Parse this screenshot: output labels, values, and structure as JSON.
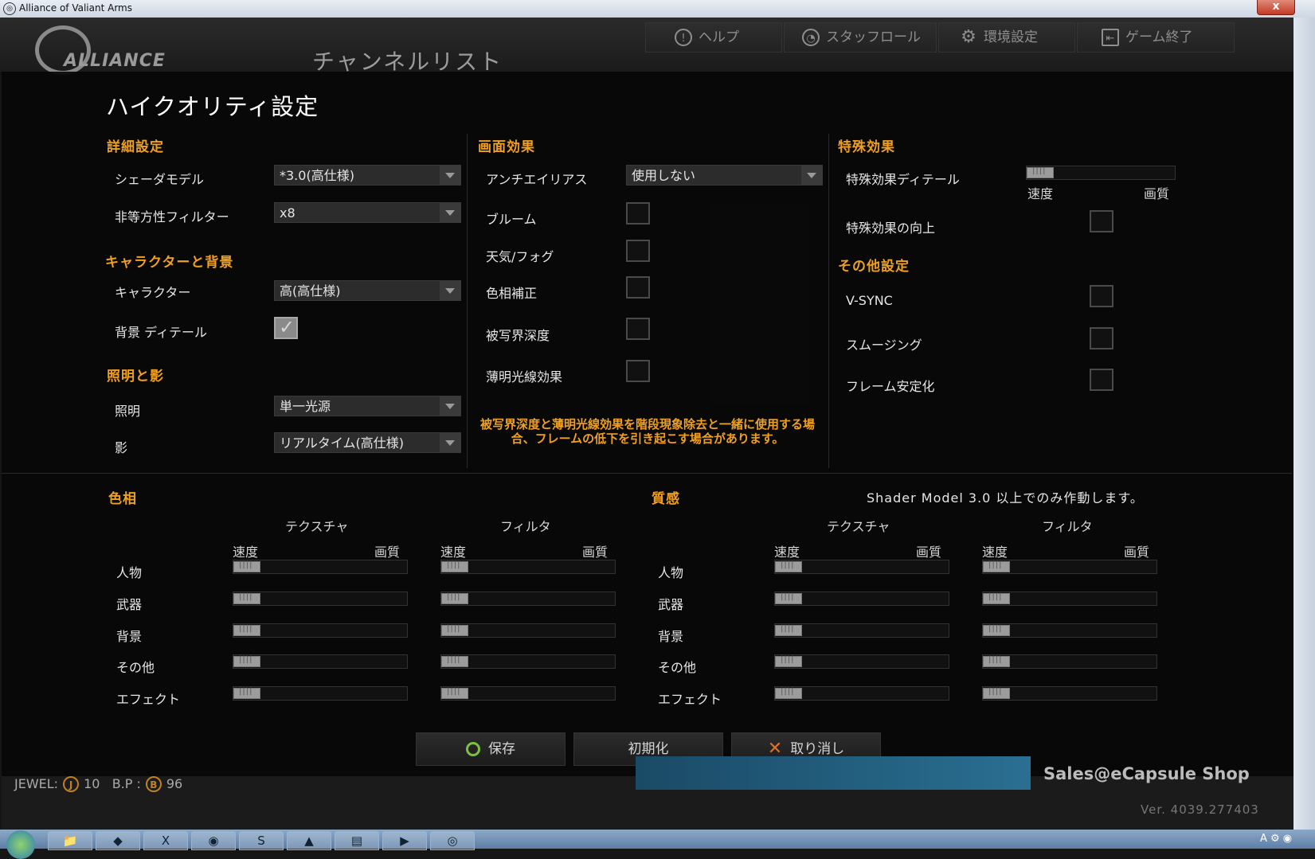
{
  "window": {
    "title": "Alliance of Valiant Arms",
    "close": "x"
  },
  "topbar": {
    "channel_title": "チャンネルリスト",
    "buttons": [
      {
        "label": "ヘルプ",
        "icon": "help-icon",
        "glyph": "!"
      },
      {
        "label": "スタッフロール",
        "icon": "staff-roll-icon",
        "glyph": "◔"
      },
      {
        "label": "環境設定",
        "icon": "gear-icon",
        "glyph": "⚙"
      },
      {
        "label": "ゲーム終了",
        "icon": "exit-icon",
        "glyph": "⇤"
      }
    ]
  },
  "dialog": {
    "title": "ハイクオリティ設定",
    "details": {
      "heading": "詳細設定",
      "shader_model": {
        "label": "シェーダモデル",
        "value": "*3.0(高仕様)"
      },
      "anisotropic": {
        "label": "非等方性フィルター",
        "value": "x8"
      }
    },
    "character_bg": {
      "heading": "キャラクターと背景",
      "character": {
        "label": "キャラクター",
        "value": "高(高仕様)"
      },
      "bg_detail": {
        "label": "背景 ディテール",
        "checked": true
      }
    },
    "lighting": {
      "heading": "照明と影",
      "lighting": {
        "label": "照明",
        "value": "単一光源"
      },
      "shadow": {
        "label": "影",
        "value": "リアルタイム(高仕様)"
      }
    },
    "screen_effects": {
      "heading": "画面効果",
      "antialias": {
        "label": "アンチエイリアス",
        "value": "使用しない"
      },
      "checkboxes": [
        {
          "label": "ブルーム",
          "checked": false
        },
        {
          "label": "天気/フォグ",
          "checked": false
        },
        {
          "label": "色相補正",
          "checked": false
        },
        {
          "label": "被写界深度",
          "checked": false
        },
        {
          "label": "薄明光線効果",
          "checked": false
        }
      ],
      "warning": "被写界深度と薄明光線効果を階段現象除去と一緒に使用する場合、フレームの低下を引き起こす場合があります。"
    },
    "special_effects": {
      "heading": "特殊効果",
      "detail": {
        "label": "特殊効果ディテール",
        "min_label": "速度",
        "max_label": "画質",
        "level": 0
      },
      "improve": {
        "label": "特殊効果の向上",
        "checked": false
      }
    },
    "other": {
      "heading": "その他設定",
      "checkboxes": [
        {
          "label": "V-SYNC",
          "checked": false
        },
        {
          "label": "スムージング",
          "checked": false
        },
        {
          "label": "フレーム安定化",
          "checked": false
        }
      ]
    },
    "hue": {
      "heading": "色相",
      "col_texture": "テクスチャ",
      "col_filter": "フィルタ",
      "speed": "速度",
      "quality": "画質",
      "rows": [
        "人物",
        "武器",
        "背景",
        "その他",
        "エフェクト"
      ]
    },
    "texture_quality": {
      "heading": "質感",
      "note": "Shader Model 3.0 以上でのみ作動します。",
      "col_texture": "テクスチャ",
      "col_filter": "フィルタ",
      "speed": "速度",
      "quality": "画質",
      "rows": [
        "人物",
        "武器",
        "背景",
        "その他",
        "エフェクト"
      ]
    },
    "buttons": {
      "save": "保存",
      "reset": "初期化",
      "cancel": "取り消し"
    }
  },
  "status": {
    "jewel_label": "JEWEL:",
    "jewel_icon": "J",
    "jewel_value": "10",
    "bp_label": "B.P :",
    "bp_icon": "B",
    "bp_value": "96",
    "sales": "Sales@eCapsule Shop",
    "version": "Ver. 4039.277403"
  },
  "colors": {
    "accent": "#f0a020",
    "dialog_bg": "#080808"
  }
}
